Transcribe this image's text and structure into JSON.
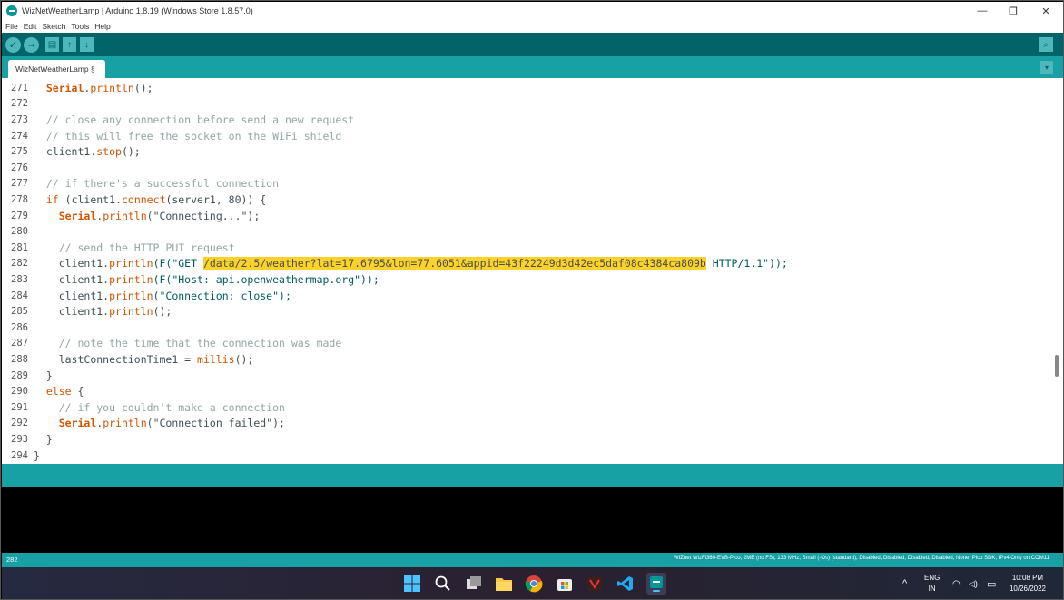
{
  "window": {
    "title": "WizNetWeatherLamp | Arduino 1.8.19 (Windows Store 1.8.57.0)",
    "minimize": "—",
    "restore": "❐",
    "close": "✕"
  },
  "menu": [
    "File",
    "Edit",
    "Sketch",
    "Tools",
    "Help"
  ],
  "toolbar": {
    "verify_icon": "✓",
    "upload_icon": "→",
    "new_icon": "▤",
    "open_icon": "↑",
    "save_icon": "↓",
    "serial_icon": "⌕"
  },
  "tab": {
    "label": "WizNetWeatherLamp §",
    "menu_icon": "▾"
  },
  "editor": {
    "lines": [
      {
        "n": "271"
      },
      {
        "n": "272"
      },
      {
        "n": "273"
      },
      {
        "n": "274"
      },
      {
        "n": "275"
      },
      {
        "n": "276"
      },
      {
        "n": "277"
      },
      {
        "n": "278"
      },
      {
        "n": "279"
      },
      {
        "n": "280"
      },
      {
        "n": "281"
      },
      {
        "n": "282"
      },
      {
        "n": "283"
      },
      {
        "n": "284"
      },
      {
        "n": "285"
      },
      {
        "n": "286"
      },
      {
        "n": "287"
      },
      {
        "n": "288"
      },
      {
        "n": "289"
      },
      {
        "n": "290"
      },
      {
        "n": "291"
      },
      {
        "n": "292"
      },
      {
        "n": "293"
      },
      {
        "n": "294"
      }
    ],
    "c271_obj": "Serial",
    "c271_dot": ".",
    "c271_fn": "println",
    "c271_rest": "();",
    "c273": "// close any connection before send a new request",
    "c274": "// this will free the socket on the WiFi shield",
    "c275_a": "client1.",
    "c275_fn": "stop",
    "c275_b": "();",
    "c277": "// if there's a successful connection",
    "c278_kw": "if",
    "c278_a": " (client1.",
    "c278_fn": "connect",
    "c278_b": "(server1, 80)) {",
    "c279_obj": "Serial",
    "c279_dot": ".",
    "c279_fn": "println",
    "c279_b": "(\"Connecting...\");",
    "c281": "// send the HTTP PUT request",
    "c282_a": "client1.",
    "c282_fn": "println",
    "c282_b": "(F(\"GET ",
    "c282_hl": "/data/2.5/weather?lat=17.6795&lon=77.6051&appid=43f22249d3d42ec5daf08c4384ca809b",
    "c282_c": " HTTP/1.1\"));",
    "c283_a": "client1.",
    "c283_fn": "println",
    "c283_b": "(F(\"Host: api.openweathermap.org\"));",
    "c284_a": "client1.",
    "c284_fn": "println",
    "c284_b": "(\"Connection: close\");",
    "c285_a": "client1.",
    "c285_fn": "println",
    "c285_b": "();",
    "c287": "// note the time that the connection was made",
    "c288_a": "lastConnectionTime1 = ",
    "c288_fn": "millis",
    "c288_b": "();",
    "c289": "}",
    "c290_kw": "else",
    "c290_b": " {",
    "c291": "// if you couldn't make a connection",
    "c292_obj": "Serial",
    "c292_dot": ".",
    "c292_fn": "println",
    "c292_b": "(\"Connection failed\");",
    "c293": "}",
    "c294": "}"
  },
  "status": {
    "line": "282",
    "board": "WIZnet WizFi360-EVB-Pico, 2MB (no FS), 133 MHz, Small (-Os) (standard), Disabled, Disabled, Disabled, Disabled, None, Pico SDK, IPv4 Only on COM11"
  },
  "taskbar": {
    "lang1": "ENG",
    "lang2": "IN",
    "time": "10:08 PM",
    "date": "10/26/2022",
    "chevron": "^",
    "wifi_icon": "◠",
    "volume_icon": "◁)",
    "battery_icon": "▭"
  }
}
